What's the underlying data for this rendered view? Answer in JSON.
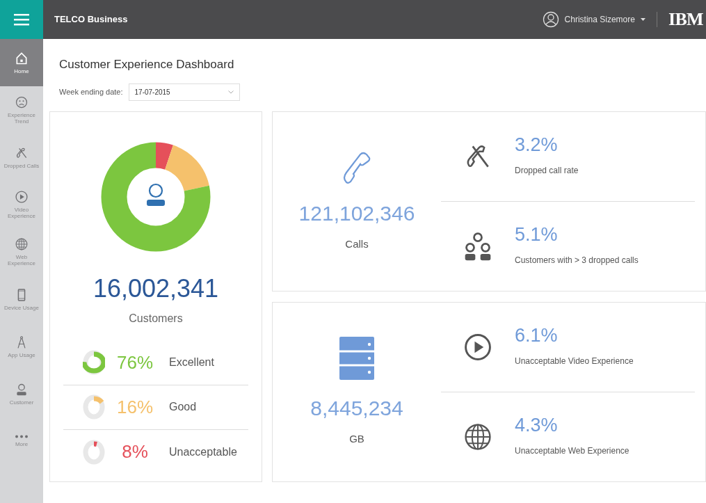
{
  "header": {
    "app_title": "TELCO Business",
    "user_name": "Christina Sizemore",
    "brand": "IBM"
  },
  "sidebar": {
    "items": [
      {
        "kind": "home",
        "label": "Home",
        "selected": true
      },
      {
        "kind": "face",
        "label": "Experience Trend",
        "selected": false
      },
      {
        "kind": "dropped",
        "label": "Dropped Calls",
        "selected": false
      },
      {
        "kind": "play",
        "label": "Video Experience",
        "selected": false
      },
      {
        "kind": "globe",
        "label": "Web Experience",
        "selected": false
      },
      {
        "kind": "device",
        "label": "Device Usage",
        "selected": false
      },
      {
        "kind": "compass",
        "label": "App Usage",
        "selected": false
      },
      {
        "kind": "person",
        "label": "Customer",
        "selected": false
      },
      {
        "kind": "more",
        "label": "More",
        "selected": false
      }
    ]
  },
  "page": {
    "title": "Customer Experience Dashboard",
    "date_label": "Week ending date:",
    "date_value": "17-07-2015"
  },
  "customers": {
    "total": "16,002,341",
    "label": "Customers",
    "breakdown": [
      {
        "percent": "76%",
        "label": "Excellent",
        "level": 0.76,
        "color": "#7cc63f"
      },
      {
        "percent": "16%",
        "label": "Good",
        "level": 0.16,
        "color": "#f5c16c"
      },
      {
        "percent": "8%",
        "label": "Unacceptable",
        "level": 0.05,
        "color": "#e5505a"
      }
    ]
  },
  "panels": [
    {
      "kind": "calls",
      "total": "121,102,346",
      "unit": "Calls",
      "metrics": [
        {
          "kind": "dropped",
          "value": "3.2%",
          "label": "Dropped call rate"
        },
        {
          "kind": "people",
          "value": "5.1%",
          "label": "Customers with > 3 dropped calls"
        }
      ]
    },
    {
      "kind": "data",
      "total": "8,445,234",
      "unit": "GB",
      "metrics": [
        {
          "kind": "play",
          "value": "6.1%",
          "label": "Unacceptable Video Experience"
        },
        {
          "kind": "globe",
          "value": "4.3%",
          "label": "Unacceptable Web Experience"
        }
      ]
    }
  ]
}
